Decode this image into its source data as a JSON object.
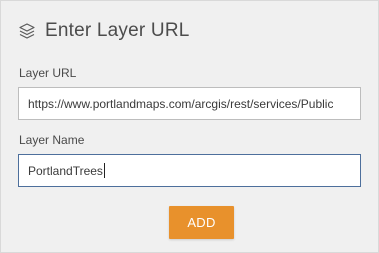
{
  "header": {
    "icon": "layers-icon",
    "title": "Enter Layer URL"
  },
  "layer_url": {
    "label": "Layer URL",
    "value": "https://www.portlandmaps.com/arcgis/rest/services/Public"
  },
  "layer_name": {
    "label": "Layer Name",
    "value": "PortlandTrees"
  },
  "actions": {
    "add_label": "ADD"
  },
  "colors": {
    "accent": "#e8912c",
    "focus_border": "#4d6f9c",
    "panel_bg": "#f0f0f0"
  }
}
